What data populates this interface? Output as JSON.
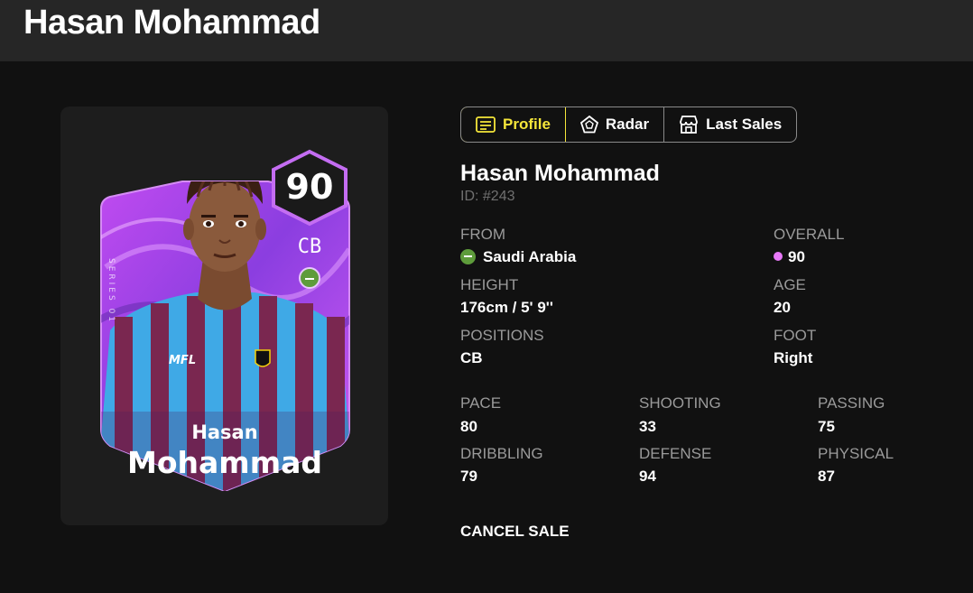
{
  "header": {
    "title": "Hasan Mohammad"
  },
  "card": {
    "rating": "90",
    "position": "CB",
    "first_name": "Hasan",
    "last_name": "Mohammad",
    "series_text": "SERIES 01",
    "shirt_brand": "MFL",
    "colors": {
      "card": "#a855f7",
      "shirt_primary": "#7a2750",
      "shirt_secondary": "#3fa9e6",
      "skin": "#8a5a3c"
    }
  },
  "tabs": [
    {
      "label": "Profile",
      "icon": "profile-list-icon",
      "active": true
    },
    {
      "label": "Radar",
      "icon": "pentagon-radar-icon",
      "active": false
    },
    {
      "label": "Last Sales",
      "icon": "storefront-icon",
      "active": false
    }
  ],
  "player": {
    "name": "Hasan Mohammad",
    "id": "ID: #243"
  },
  "info": {
    "from_label": "FROM",
    "from_value": "Saudi Arabia",
    "overall_label": "OVERALL",
    "overall_value": "90",
    "height_label": "HEIGHT",
    "height_value": "176cm / 5' 9''",
    "age_label": "AGE",
    "age_value": "20",
    "positions_label": "POSITIONS",
    "positions_value": "CB",
    "foot_label": "FOOT",
    "foot_value": "Right"
  },
  "stats": [
    {
      "label": "PACE",
      "value": "80"
    },
    {
      "label": "SHOOTING",
      "value": "33"
    },
    {
      "label": "PASSING",
      "value": "75"
    },
    {
      "label": "DRIBBLING",
      "value": "79"
    },
    {
      "label": "DEFENSE",
      "value": "94"
    },
    {
      "label": "PHYSICAL",
      "value": "87"
    }
  ],
  "actions": {
    "cancel_sale": "CANCEL SALE"
  },
  "colors": {
    "accent": "#f5e63a",
    "overall_dot": "#e879f9",
    "flag": "#5e9c3b"
  }
}
